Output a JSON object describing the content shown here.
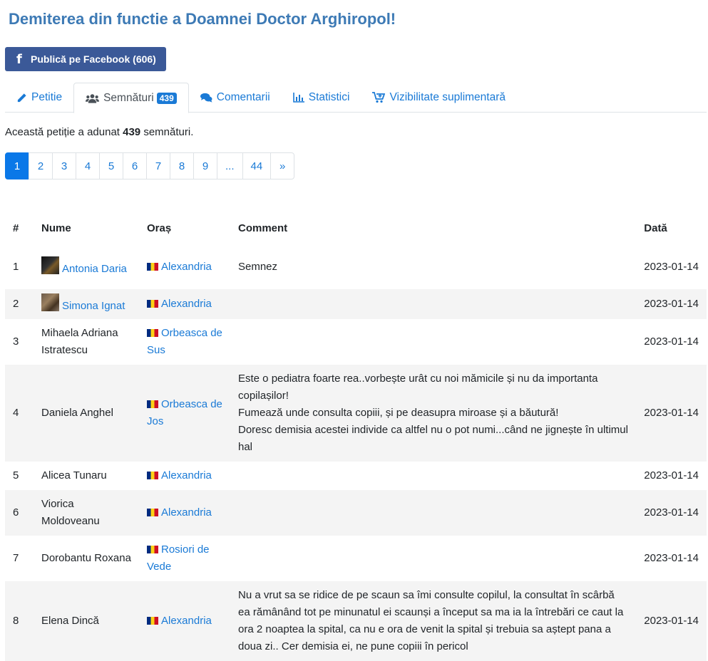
{
  "title": "Demiterea din functie a Doamnei Doctor Arghiropol!",
  "facebook": {
    "label": "Publică pe Facebook (606)",
    "icon": "facebook-icon"
  },
  "tabs": [
    {
      "label": "Petitie",
      "icon": "pencil-icon"
    },
    {
      "label": "Semnături",
      "icon": "users-icon",
      "badge": "439"
    },
    {
      "label": "Comentarii",
      "icon": "comments-icon"
    },
    {
      "label": "Statistici",
      "icon": "bar-chart-icon"
    },
    {
      "label": "Vizibilitate suplimentară",
      "icon": "cart-plus-icon"
    }
  ],
  "summary": {
    "prefix": "Această petiție a adunat",
    "count": "439",
    "suffix": "semnături."
  },
  "pagination": [
    "1",
    "2",
    "3",
    "4",
    "5",
    "6",
    "7",
    "8",
    "9",
    "...",
    "44",
    "»"
  ],
  "table": {
    "headers": [
      "#",
      "Nume",
      "Oraș",
      "Comment",
      "Dată"
    ],
    "rows": [
      {
        "num": "1",
        "name": "Antonia Daria",
        "name_link": true,
        "avatar": "av1",
        "city": "Alexandria",
        "comment": "Semnez",
        "date": "2023-01-14"
      },
      {
        "num": "2",
        "name": "Simona Ignat",
        "name_link": true,
        "avatar": "av2",
        "city": "Alexandria",
        "comment": "",
        "date": "2023-01-14"
      },
      {
        "num": "3",
        "name": "Mihaela Adriana Istratescu",
        "name_link": false,
        "avatar": "",
        "city": "Orbeasca de Sus",
        "comment": "",
        "date": "2023-01-14"
      },
      {
        "num": "4",
        "name": "Daniela Anghel",
        "name_link": false,
        "avatar": "",
        "city": "Orbeasca de Jos",
        "comment": "Este o pediatra foarte rea..vorbește urât cu noi mămicile și nu da importanta copilașilor!\nFumează unde consulta copiii, și pe deasupra miroase și a băutură!\nDoresc demisia acestei individe ca altfel nu o pot numi...când ne jignește în ultimul hal",
        "date": "2023-01-14"
      },
      {
        "num": "5",
        "name": "Alicea Tunaru",
        "name_link": false,
        "avatar": "",
        "city": "Alexandria",
        "comment": "",
        "date": "2023-01-14"
      },
      {
        "num": "6",
        "name": "Viorica Moldoveanu",
        "name_link": false,
        "avatar": "",
        "city": "Alexandria",
        "comment": "",
        "date": "2023-01-14"
      },
      {
        "num": "7",
        "name": "Dorobantu Roxana",
        "name_link": false,
        "avatar": "",
        "city": "Rosiori de Vede",
        "comment": "",
        "date": "2023-01-14"
      },
      {
        "num": "8",
        "name": "Elena Dincă",
        "name_link": false,
        "avatar": "",
        "city": "Alexandria",
        "comment": "Nu a vrut sa se ridice de pe scaun sa îmi consulte copilul, la consultat în scârbă ea rămânând tot pe minunatul ei scaunși a început sa ma ia la întrebări ce caut la ora 2 noaptea la spital, ca nu e ora de venit la spital și trebuia sa aștept pana a doua zi.. Cer demisia ei, ne pune copiii în pericol",
        "date": "2023-01-14"
      }
    ]
  },
  "colors": {
    "title": "#3d7ab5",
    "facebook": "#3b5998",
    "link": "#1a7ad6",
    "active_page": "#0a78e8"
  }
}
